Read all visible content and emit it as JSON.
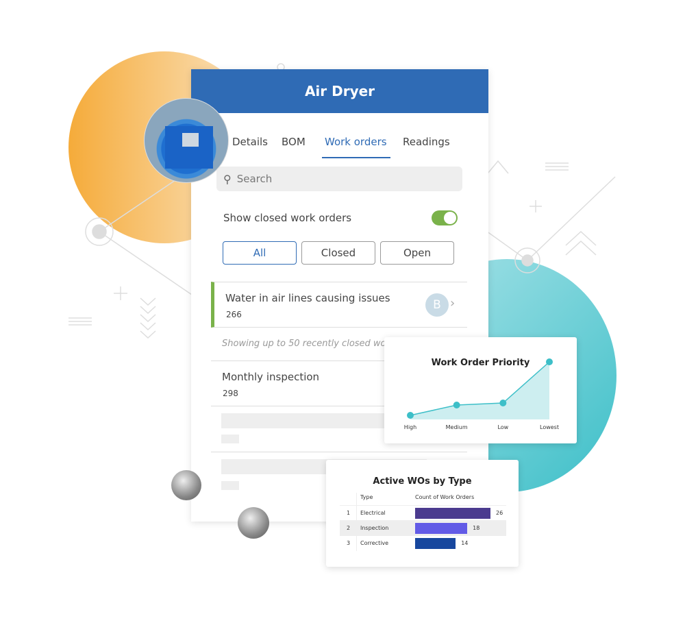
{
  "panel": {
    "title": "Air Dryer",
    "tabs": [
      {
        "label": "Details"
      },
      {
        "label": "BOM"
      },
      {
        "label": "Work orders",
        "active": true
      },
      {
        "label": "Readings"
      }
    ],
    "search": {
      "placeholder": "Search",
      "icon": "search-icon"
    },
    "show_closed": {
      "label": "Show closed work orders",
      "on": true
    },
    "filters": [
      {
        "label": "All",
        "selected": true
      },
      {
        "label": "Closed"
      },
      {
        "label": "Open"
      }
    ],
    "work_orders": [
      {
        "title": "Water in air lines causing issues",
        "id": "266",
        "avatar": "B",
        "status_color": "#7ab24a"
      },
      {
        "title": "Monthly inspection",
        "id": "298"
      }
    ],
    "note": "Showing up to 50 recently closed work"
  },
  "colors": {
    "header": "#2f6bb5",
    "accent": "#2f6bb5",
    "toggle": "#7ab24a",
    "teal": "#3dbfc8"
  },
  "chart_data": [
    {
      "type": "area",
      "title": "Work Order Priority",
      "categories": [
        "High",
        "Medium",
        "Low",
        "Lowest"
      ],
      "values": [
        2,
        7,
        8,
        28
      ],
      "grid": false
    },
    {
      "type": "bar",
      "title": "Active WOs by Type",
      "columns": [
        "Type",
        "Count of Work Orders"
      ],
      "rows": [
        {
          "rank": "1",
          "type": "Electrical",
          "value": 26,
          "color": "#4b3b8f"
        },
        {
          "rank": "2",
          "type": "Inspection",
          "value": 18,
          "color": "#625be6"
        },
        {
          "rank": "3",
          "type": "Corrective",
          "value": 14,
          "color": "#17479e"
        }
      ]
    }
  ]
}
